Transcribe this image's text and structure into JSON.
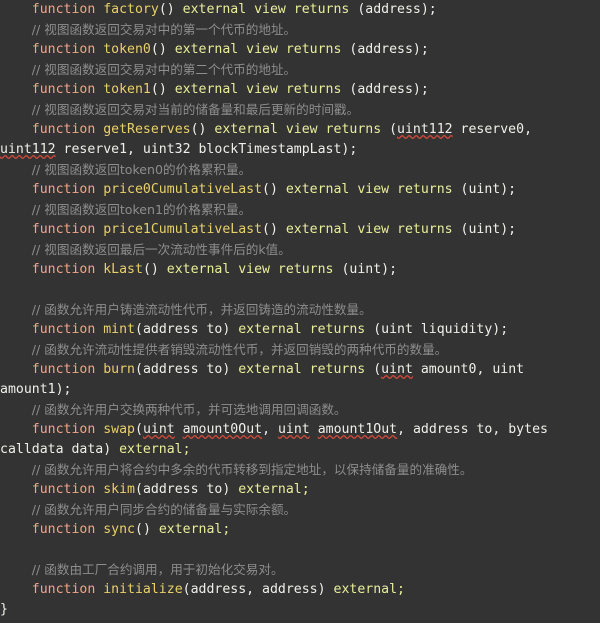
{
  "editor": {
    "theme_background": "#333333",
    "language": "solidity",
    "keyword_color": "#f2a48c",
    "function_name_color": "#e8d16a",
    "modifier_color": "#e9ee9a",
    "plain_color": "#f0f0ea",
    "comment_color": "#8d8d8d",
    "spellcheck_underline_color": "#d04a3a"
  },
  "lines": [
    {
      "id": "line-1",
      "kind": "code",
      "indent": "    ",
      "tokens": [
        {
          "t": "function ",
          "c": "kw"
        },
        {
          "t": "factory",
          "c": "fname"
        },
        {
          "t": "() ",
          "c": "plain"
        },
        {
          "t": "external view returns ",
          "c": "mod"
        },
        {
          "t": "(address);",
          "c": "plain"
        }
      ],
      "text": "    function factory() external view returns (address);"
    },
    {
      "id": "line-2",
      "kind": "comment",
      "indent": "    ",
      "text": "    // 视图函数返回交易对中的第一个代币的地址。"
    },
    {
      "id": "line-3",
      "kind": "code",
      "indent": "    ",
      "tokens": [
        {
          "t": "function ",
          "c": "kw"
        },
        {
          "t": "token0",
          "c": "fname"
        },
        {
          "t": "() ",
          "c": "plain"
        },
        {
          "t": "external view returns ",
          "c": "mod"
        },
        {
          "t": "(address);",
          "c": "plain"
        }
      ],
      "text": "    function token0() external view returns (address);"
    },
    {
      "id": "line-4",
      "kind": "comment",
      "indent": "    ",
      "text": "    // 视图函数返回交易对中的第二个代币的地址。"
    },
    {
      "id": "line-5",
      "kind": "code",
      "indent": "    ",
      "tokens": [
        {
          "t": "function ",
          "c": "kw"
        },
        {
          "t": "token1",
          "c": "fname"
        },
        {
          "t": "() ",
          "c": "plain"
        },
        {
          "t": "external view returns ",
          "c": "mod"
        },
        {
          "t": "(address);",
          "c": "plain"
        }
      ],
      "text": "    function token1() external view returns (address);"
    },
    {
      "id": "line-6",
      "kind": "comment",
      "indent": "    ",
      "text": "    // 视图函数返回交易对当前的储备量和最后更新的时间戳。"
    },
    {
      "id": "line-7",
      "kind": "code",
      "indent": "    ",
      "tokens": [
        {
          "t": "function ",
          "c": "kw"
        },
        {
          "t": "getReserves",
          "c": "fname"
        },
        {
          "t": "() ",
          "c": "plain"
        },
        {
          "t": "external view returns ",
          "c": "mod"
        },
        {
          "t": "(",
          "c": "plain"
        },
        {
          "t": "uint112",
          "c": "plain err"
        },
        {
          "t": " reserve0,",
          "c": "plain"
        }
      ],
      "text": "    function getReserves() external view returns (uint112 reserve0,"
    },
    {
      "id": "line-7b",
      "kind": "code-wrap",
      "indent": "",
      "tokens": [
        {
          "t": "uint112",
          "c": "plain err"
        },
        {
          "t": " reserve1, uint32 blockTimestampLast);",
          "c": "plain"
        }
      ],
      "text": "uint112 reserve1, uint32 blockTimestampLast);"
    },
    {
      "id": "line-8",
      "kind": "comment",
      "indent": "    ",
      "text": "    // 视图函数返回token0的价格累积量。"
    },
    {
      "id": "line-9",
      "kind": "code",
      "indent": "    ",
      "tokens": [
        {
          "t": "function ",
          "c": "kw"
        },
        {
          "t": "price0CumulativeLast",
          "c": "fname"
        },
        {
          "t": "() ",
          "c": "plain"
        },
        {
          "t": "external view returns ",
          "c": "mod"
        },
        {
          "t": "(uint);",
          "c": "plain"
        }
      ],
      "text": "    function price0CumulativeLast() external view returns (uint);"
    },
    {
      "id": "line-10",
      "kind": "comment",
      "indent": "    ",
      "text": "    // 视图函数返回token1的价格累积量。"
    },
    {
      "id": "line-11",
      "kind": "code",
      "indent": "    ",
      "tokens": [
        {
          "t": "function ",
          "c": "kw"
        },
        {
          "t": "price1CumulativeLast",
          "c": "fname"
        },
        {
          "t": "() ",
          "c": "plain"
        },
        {
          "t": "external view returns ",
          "c": "mod"
        },
        {
          "t": "(uint);",
          "c": "plain"
        }
      ],
      "text": "    function price1CumulativeLast() external view returns (uint);"
    },
    {
      "id": "line-12",
      "kind": "comment",
      "indent": "    ",
      "text": "    // 视图函数返回最后一次流动性事件后的k值。"
    },
    {
      "id": "line-13",
      "kind": "code",
      "indent": "    ",
      "tokens": [
        {
          "t": "function ",
          "c": "kw"
        },
        {
          "t": "kLast",
          "c": "fname"
        },
        {
          "t": "() ",
          "c": "plain"
        },
        {
          "t": "external view returns ",
          "c": "mod"
        },
        {
          "t": "(uint);",
          "c": "plain"
        }
      ],
      "text": "    function kLast() external view returns (uint);"
    },
    {
      "id": "line-14",
      "kind": "blank",
      "text": ""
    },
    {
      "id": "line-15",
      "kind": "comment",
      "indent": "    ",
      "text": "    // 函数允许用户铸造流动性代币，并返回铸造的流动性数量。"
    },
    {
      "id": "line-16",
      "kind": "code",
      "indent": "    ",
      "tokens": [
        {
          "t": "function ",
          "c": "kw"
        },
        {
          "t": "mint",
          "c": "fname"
        },
        {
          "t": "(address to) ",
          "c": "plain"
        },
        {
          "t": "external returns ",
          "c": "mod"
        },
        {
          "t": "(uint liquidity);",
          "c": "plain"
        }
      ],
      "text": "    function mint(address to) external returns (uint liquidity);"
    },
    {
      "id": "line-17",
      "kind": "comment",
      "indent": "    ",
      "text": "    // 函数允许流动性提供者销毁流动性代币，并返回销毁的两种代币的数量。"
    },
    {
      "id": "line-18",
      "kind": "code",
      "indent": "    ",
      "tokens": [
        {
          "t": "function ",
          "c": "kw"
        },
        {
          "t": "burn",
          "c": "fname"
        },
        {
          "t": "(address to) ",
          "c": "plain"
        },
        {
          "t": "external returns ",
          "c": "mod"
        },
        {
          "t": "(",
          "c": "plain"
        },
        {
          "t": "uint",
          "c": "plain err"
        },
        {
          "t": " amount0, uint",
          "c": "plain"
        }
      ],
      "text": "    function burn(address to) external returns (uint amount0, uint"
    },
    {
      "id": "line-18b",
      "kind": "code-wrap",
      "indent": "",
      "tokens": [
        {
          "t": "amount1);",
          "c": "plain"
        }
      ],
      "text": "amount1);"
    },
    {
      "id": "line-19",
      "kind": "comment",
      "indent": "    ",
      "text": "    // 函数允许用户交换两种代币，并可选地调用回调函数。"
    },
    {
      "id": "line-20",
      "kind": "code",
      "indent": "    ",
      "tokens": [
        {
          "t": "function ",
          "c": "kw"
        },
        {
          "t": "swap",
          "c": "fname"
        },
        {
          "t": "(",
          "c": "plain"
        },
        {
          "t": "uint",
          "c": "plain err"
        },
        {
          "t": " ",
          "c": "plain"
        },
        {
          "t": "amount0Out",
          "c": "plain err"
        },
        {
          "t": ", ",
          "c": "plain"
        },
        {
          "t": "uint",
          "c": "plain err"
        },
        {
          "t": " ",
          "c": "plain"
        },
        {
          "t": "amount1Out",
          "c": "plain err"
        },
        {
          "t": ", address to, bytes",
          "c": "plain"
        }
      ],
      "text": "    function swap(uint amount0Out, uint amount1Out, address to, bytes"
    },
    {
      "id": "line-20b",
      "kind": "code-wrap",
      "indent": "",
      "tokens": [
        {
          "t": "calldata data) ",
          "c": "plain"
        },
        {
          "t": "external;",
          "c": "mod"
        }
      ],
      "text": "calldata data) external;"
    },
    {
      "id": "line-21",
      "kind": "comment",
      "indent": "    ",
      "text": "    // 函数允许用户将合约中多余的代币转移到指定地址，以保持储备量的准确性。"
    },
    {
      "id": "line-22",
      "kind": "code",
      "indent": "    ",
      "tokens": [
        {
          "t": "function ",
          "c": "kw"
        },
        {
          "t": "skim",
          "c": "fname"
        },
        {
          "t": "(address to) ",
          "c": "plain"
        },
        {
          "t": "external;",
          "c": "mod"
        }
      ],
      "text": "    function skim(address to) external;"
    },
    {
      "id": "line-23",
      "kind": "comment",
      "indent": "    ",
      "text": "    // 函数允许用户同步合约的储备量与实际余额。"
    },
    {
      "id": "line-24",
      "kind": "code",
      "indent": "    ",
      "tokens": [
        {
          "t": "function ",
          "c": "kw"
        },
        {
          "t": "sync",
          "c": "fname"
        },
        {
          "t": "() ",
          "c": "plain"
        },
        {
          "t": "external;",
          "c": "mod"
        }
      ],
      "text": "    function sync() external;"
    },
    {
      "id": "line-25",
      "kind": "blank",
      "text": ""
    },
    {
      "id": "line-26",
      "kind": "comment",
      "indent": "    ",
      "text": "    // 函数由工厂合约调用，用于初始化交易对。"
    },
    {
      "id": "line-27",
      "kind": "code",
      "indent": "    ",
      "tokens": [
        {
          "t": "function ",
          "c": "kw"
        },
        {
          "t": "initialize",
          "c": "fname"
        },
        {
          "t": "(address, address) ",
          "c": "plain"
        },
        {
          "t": "external;",
          "c": "mod"
        }
      ],
      "text": "    function initialize(address, address) external;"
    },
    {
      "id": "line-28",
      "kind": "code",
      "indent": "",
      "tokens": [
        {
          "t": "}",
          "c": "plain"
        }
      ],
      "text": "}"
    }
  ]
}
